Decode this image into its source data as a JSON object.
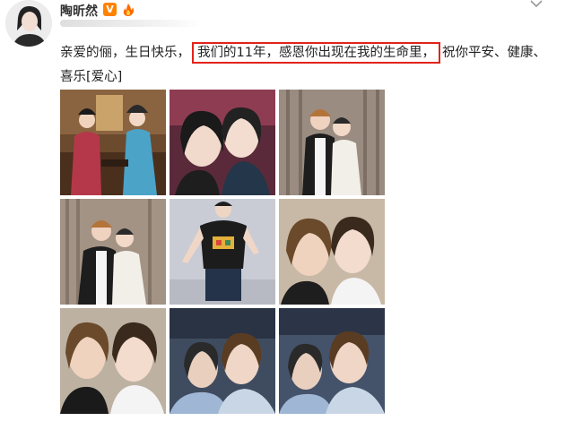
{
  "post": {
    "username": "陶昕然",
    "verified_badge": "V",
    "text_before": "亲爱的俪，生日快乐，",
    "text_highlight": "我们的11年，感恩你出现在我的生命里，",
    "text_after": "祝你平安、健康、喜乐[爱心]",
    "accent_color": "#e2231a",
    "badge_color": "#ff8200"
  },
  "icons": [
    "verified-v-icon",
    "flame-icon",
    "chevron-down-icon"
  ],
  "photos": [
    "photo-1",
    "photo-2",
    "photo-3",
    "photo-4",
    "photo-5",
    "photo-6",
    "photo-7",
    "photo-8",
    "photo-9"
  ]
}
